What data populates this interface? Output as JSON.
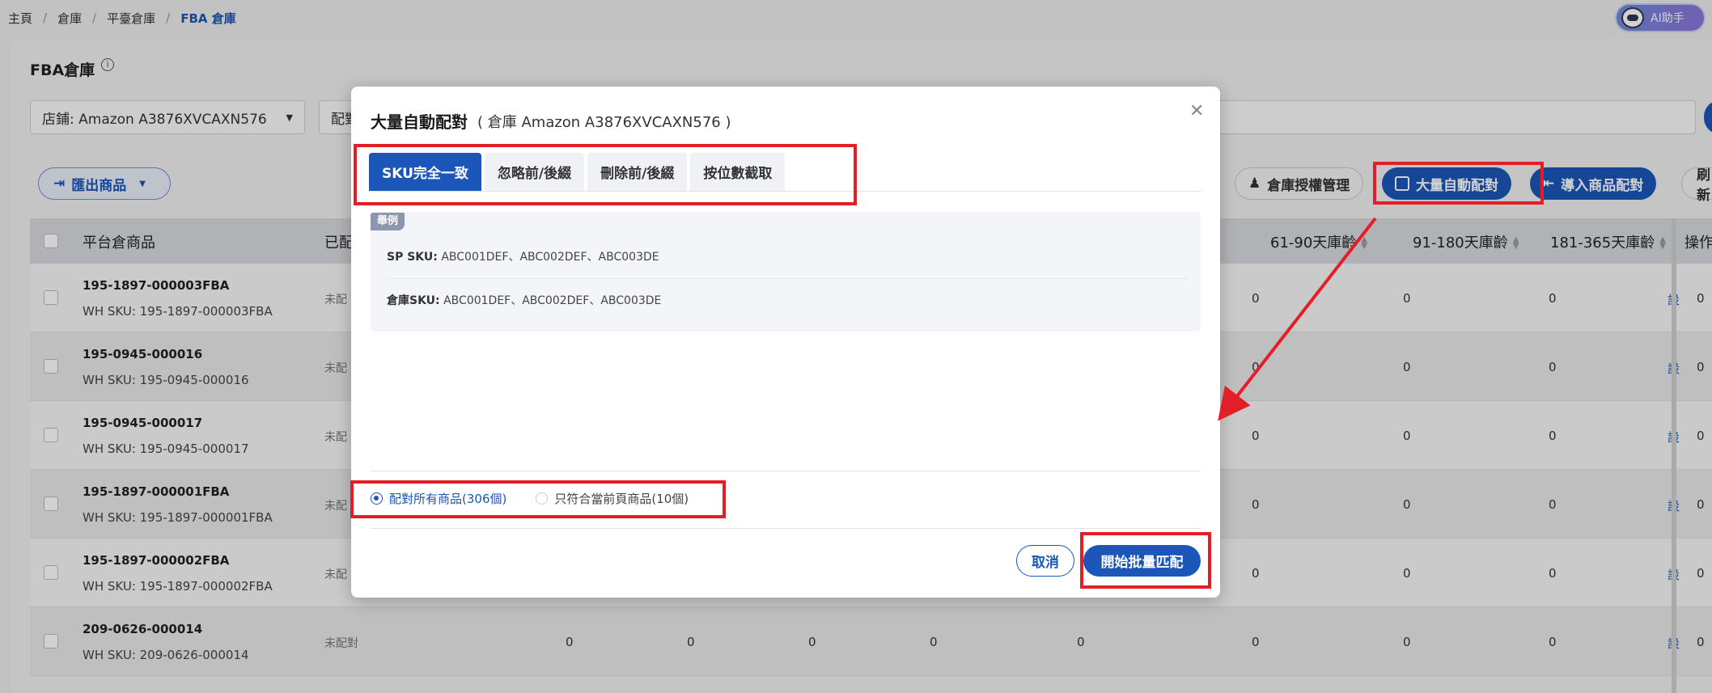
{
  "breadcrumb": [
    "主頁",
    "倉庫",
    "平臺倉庫",
    "FBA 倉庫"
  ],
  "ai_button": "AI助手",
  "page": {
    "title": "FBA倉庫",
    "shop_filter": "店鋪: Amazon A3876XVCAXN576",
    "match_filter": "配對",
    "export_button": "匯出商品",
    "toolbar": {
      "warehouse_auth": "倉庫授權管理",
      "bulk_auto_match": "大量自動配對",
      "import_match": "導入商品配對",
      "refresh": "刷新"
    }
  },
  "table": {
    "headers": {
      "platform_item": "平台倉商品",
      "matched": "已配",
      "age_61_90": "61-90天庫齡",
      "age_91_180": "91-180天庫齡",
      "age_181_365": "181-365天庫齡",
      "actions": "操作"
    },
    "rows": [
      {
        "sku": "195-1897-000003FBA",
        "wh": "WH SKU: 195-1897-000003FBA",
        "status": "未配",
        "v1": "0",
        "v2": "0",
        "v3": "0",
        "v4": "0",
        "action": "設"
      },
      {
        "sku": "195-0945-000016",
        "wh": "WH SKU: 195-0945-000016",
        "status": "未配",
        "v1": "0",
        "v2": "0",
        "v3": "0",
        "v4": "0",
        "action": "設"
      },
      {
        "sku": "195-0945-000017",
        "wh": "WH SKU: 195-0945-000017",
        "status": "未配",
        "v1": "0",
        "v2": "0",
        "v3": "0",
        "v4": "0",
        "action": "設"
      },
      {
        "sku": "195-1897-000001FBA",
        "wh": "WH SKU: 195-1897-000001FBA",
        "status": "未配",
        "v1": "0",
        "v2": "0",
        "v3": "0",
        "v4": "0",
        "action": "設"
      },
      {
        "sku": "195-1897-000002FBA",
        "wh": "WH SKU: 195-1897-000002FBA",
        "status": "未配",
        "v1": "0",
        "v2": "0",
        "v3": "0",
        "v4": "0",
        "action": "設"
      },
      {
        "sku": "209-0626-000014",
        "wh": "WH SKU: 209-0626-000014",
        "status": "未配對",
        "v1": "0",
        "v2": "0",
        "v3": "0",
        "v4": "0",
        "action": "設"
      }
    ],
    "last_row_extra": [
      "0",
      "0",
      "0",
      "0",
      "0"
    ]
  },
  "modal": {
    "title": "大量自動配對",
    "subtitle": "( 倉庫 Amazon A3876XVCAXN576 )",
    "tabs": [
      "SKU完全一致",
      "忽略前/後綴",
      "刪除前/後綴",
      "按位數截取"
    ],
    "example_badge": "舉例",
    "example": {
      "sp_label": "SP SKU:",
      "sp_value": "ABC001DEF、ABC002DEF、ABC003DE",
      "wh_label": "倉庫SKU:",
      "wh_value": "ABC001DEF、ABC002DEF、ABC003DE"
    },
    "radio_all": "配對所有商品(306個)",
    "radio_page": "只符合當前頁商品(10個)",
    "cancel": "取消",
    "start": "開始批量匹配"
  }
}
